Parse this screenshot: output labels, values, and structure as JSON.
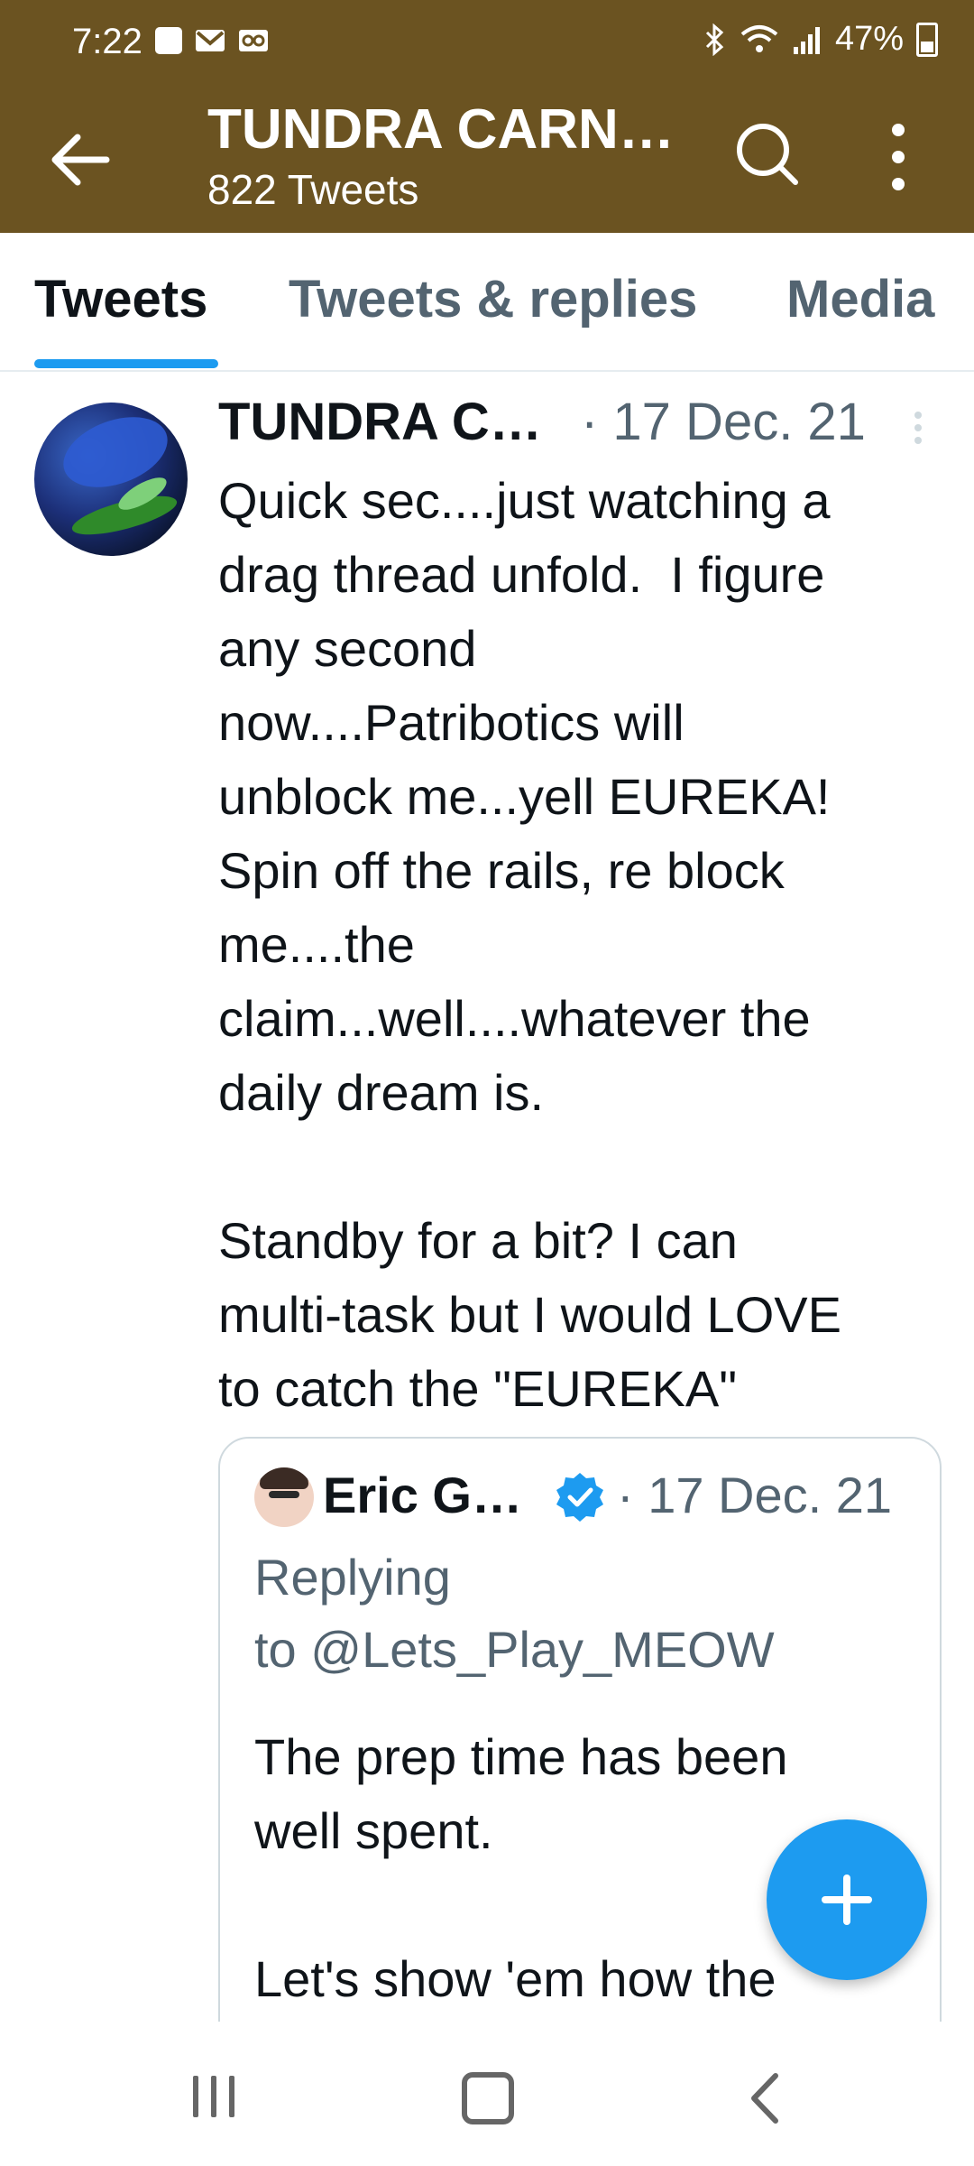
{
  "status_bar": {
    "time": "7:22",
    "battery": "47%",
    "left_icons": [
      "image-notification-icon",
      "gmail-icon",
      "voicemail-icon"
    ],
    "right_icons": [
      "bluetooth-icon",
      "wifi-icon",
      "signal-icon",
      "battery-icon"
    ]
  },
  "header": {
    "title": "TUNDRA CARN…",
    "subtitle": "822 Tweets",
    "bg_color": "#6b5321"
  },
  "tabs": [
    {
      "label": "Tweets",
      "active": true
    },
    {
      "label": "Tweets & replies",
      "active": false
    },
    {
      "label": "Media",
      "active": false
    }
  ],
  "tweet": {
    "author": "TUNDRA C…",
    "date": "· 17 Dec. 21",
    "text": "Quick sec....just watching a\ndrag thread unfold.  I figure\nany second\nnow....Patribotics will\nunblock me...yell EUREKA!\nSpin off the rails, re block\nme....the\nclaim...well....whatever the\ndaily dream is.\n\nStandby for a bit? I can\nmulti-task but I would LOVE\nto catch the \"EUREKA\"",
    "quoted": {
      "author": "Eric G…",
      "date": "· 17 Dec. 21",
      "replying_to": "Replying\nto @Lets_Play_MEOW",
      "text": "The prep time has been\nwell spent.\n\nLet's show 'em how the"
    }
  },
  "colors": {
    "accent": "#1d9bf0",
    "secondary_text": "#536471"
  }
}
